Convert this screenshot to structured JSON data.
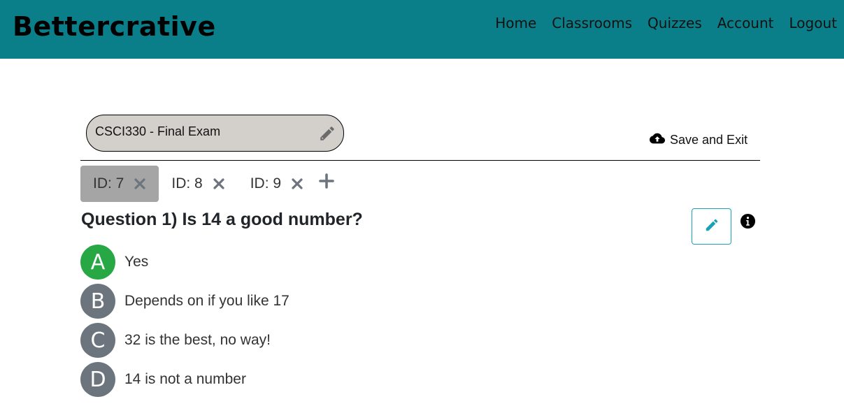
{
  "navbar": {
    "brand": "Bettercrative",
    "links": [
      "Home",
      "Classrooms",
      "Quizzes",
      "Account",
      "Logout"
    ],
    "background": "#0a7f8a"
  },
  "quiz": {
    "title": "CSCI330 - Final Exam",
    "save_label": "Save and Exit"
  },
  "tabs": [
    {
      "label": "ID: 7",
      "active": true
    },
    {
      "label": "ID: 8",
      "active": false
    },
    {
      "label": "ID: 9",
      "active": false
    }
  ],
  "question": {
    "title": "Question 1) Is 14 a good number?",
    "answers": [
      {
        "letter": "A",
        "text": "Yes",
        "correct": true
      },
      {
        "letter": "B",
        "text": "Depends on if you like 17",
        "correct": false
      },
      {
        "letter": "C",
        "text": "32 is the best, no way!",
        "correct": false
      },
      {
        "letter": "D",
        "text": "14 is not a number",
        "correct": false
      }
    ]
  },
  "colors": {
    "correct": "#28a745",
    "neutral": "#6c757d",
    "accent": "#17a2b8"
  },
  "icons": {
    "title_edit": "pencil-icon",
    "save": "cloud-upload-icon",
    "tab_close": "close-icon",
    "tab_add": "plus-icon",
    "question_edit": "pencil-icon",
    "info": "info-circle-icon"
  }
}
